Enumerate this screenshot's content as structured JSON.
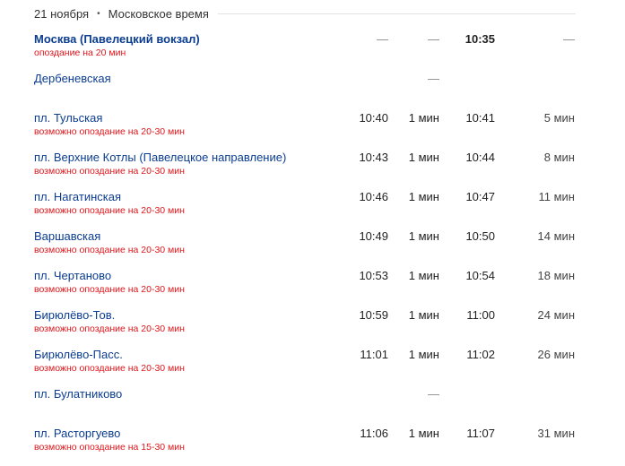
{
  "header": {
    "date": "21 ноября",
    "separator": "•",
    "timezone": "Московское время"
  },
  "stops": [
    {
      "name": "Москва (Павелецкий вокзал)",
      "delay": "опоздание на 20 мин",
      "arrival": "—",
      "stop": "—",
      "departure": "10:35",
      "duration": "—"
    },
    {
      "name": "Дербеневская",
      "delay": "",
      "arrival": "",
      "stop": "—",
      "departure": "",
      "duration": ""
    },
    {
      "name": "пл. Тульская",
      "delay": "возможно опоздание на 20-30 мин",
      "arrival": "10:40",
      "stop": "1 мин",
      "departure": "10:41",
      "duration": "5 мин"
    },
    {
      "name": "пл. Верхние Котлы (Павелецкое направление)",
      "delay": "возможно опоздание на 20-30 мин",
      "arrival": "10:43",
      "stop": "1 мин",
      "departure": "10:44",
      "duration": "8 мин"
    },
    {
      "name": "пл. Нагатинская",
      "delay": "возможно опоздание на 20-30 мин",
      "arrival": "10:46",
      "stop": "1 мин",
      "departure": "10:47",
      "duration": "11 мин"
    },
    {
      "name": "Варшавская",
      "delay": "возможно опоздание на 20-30 мин",
      "arrival": "10:49",
      "stop": "1 мин",
      "departure": "10:50",
      "duration": "14 мин"
    },
    {
      "name": "пл. Чертаново",
      "delay": "возможно опоздание на 20-30 мин",
      "arrival": "10:53",
      "stop": "1 мин",
      "departure": "10:54",
      "duration": "18 мин"
    },
    {
      "name": "Бирюлёво-Тов.",
      "delay": "возможно опоздание на 20-30 мин",
      "arrival": "10:59",
      "stop": "1 мин",
      "departure": "11:00",
      "duration": "24 мин"
    },
    {
      "name": "Бирюлёво-Пасс.",
      "delay": "возможно опоздание на 20-30 мин",
      "arrival": "11:01",
      "stop": "1 мин",
      "departure": "11:02",
      "duration": "26 мин"
    },
    {
      "name": "пл. Булатниково",
      "delay": "",
      "arrival": "",
      "stop": "—",
      "departure": "",
      "duration": ""
    },
    {
      "name": "пл. Расторгуево",
      "delay": "возможно опоздание на 15-30 мин",
      "arrival": "11:06",
      "stop": "1 мин",
      "departure": "11:07",
      "duration": "31 мин"
    }
  ]
}
